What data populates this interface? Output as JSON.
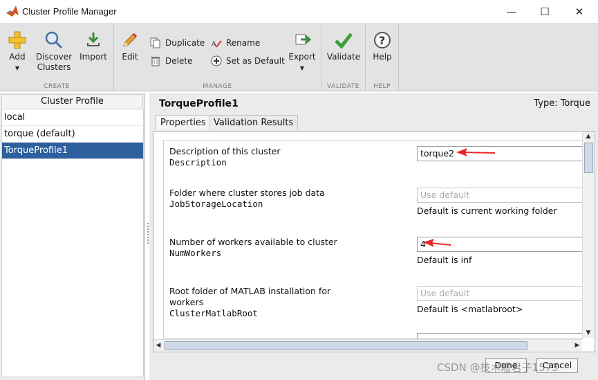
{
  "window": {
    "title": "Cluster Profile Manager",
    "controls": {
      "minimize": "—",
      "maximize": "☐",
      "close": "✕"
    }
  },
  "ribbon": {
    "groups": {
      "create": {
        "label": "CREATE",
        "buttons": {
          "add": "Add",
          "discover_line1": "Discover",
          "discover_line2": "Clusters",
          "import": "Import"
        }
      },
      "manage": {
        "label": "MANAGE",
        "buttons": {
          "edit": "Edit",
          "duplicate": "Duplicate",
          "delete": "Delete",
          "rename": "Rename",
          "set_default": "Set as Default",
          "export": "Export"
        }
      },
      "validate": {
        "label": "VALIDATE",
        "buttons": {
          "validate": "Validate"
        }
      },
      "help": {
        "label": "HELP",
        "buttons": {
          "help": "Help"
        }
      }
    }
  },
  "sidebar": {
    "header": "Cluster Profile",
    "items": [
      {
        "label": "local",
        "selected": false
      },
      {
        "label": "torque (default)",
        "selected": false
      },
      {
        "label": "TorqueProfile1",
        "selected": true
      }
    ]
  },
  "main": {
    "profile_name": "TorqueProfile1",
    "type_label": "Type: Torque",
    "tabs": [
      {
        "label": "Properties",
        "active": true
      },
      {
        "label": "Validation Results",
        "active": false
      }
    ],
    "properties": [
      {
        "description": "Description of this cluster",
        "name": "Description",
        "value": "torque2",
        "placeholder": "",
        "hint": ""
      },
      {
        "description": "Folder where cluster stores job data",
        "name": "JobStorageLocation",
        "value": "",
        "placeholder": "Use default",
        "hint": "Default is current working folder"
      },
      {
        "description": "Number of workers available to cluster",
        "name": "NumWorkers",
        "value": "4",
        "placeholder": "",
        "hint": "Default is inf"
      },
      {
        "description_line1": "Root folder of MATLAB installation for",
        "description_line2": "workers",
        "name": "ClusterMatlabRoot",
        "value": "",
        "placeholder": "Use default",
        "hint": "Default is <matlabroot>"
      }
    ]
  },
  "footer": {
    "done": "Done",
    "cancel": "Cancel"
  },
  "watermark": "CSDN @技术瞻君子1573",
  "colors": {
    "selection": "#2e5f9e",
    "annotation_arrow": "#e8262a",
    "ribbon_bg": "#e3e3e3"
  }
}
